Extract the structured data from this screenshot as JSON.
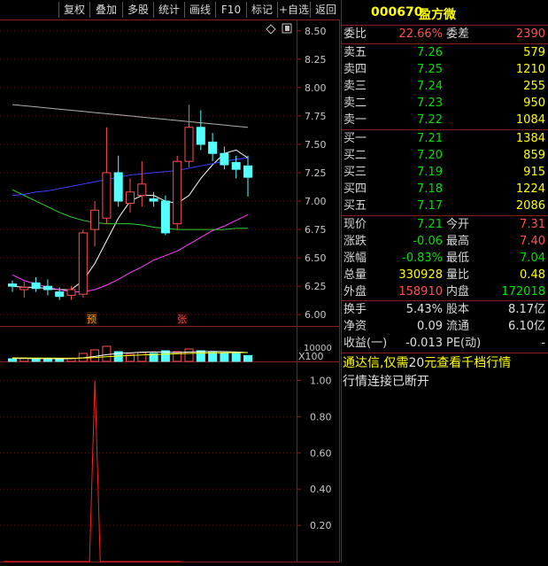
{
  "toolbar": {
    "buttons": [
      "复权",
      "叠加",
      "多股",
      "统计",
      "画线",
      "F10",
      "标记",
      "+自选",
      "返回"
    ]
  },
  "price_axis": [
    "8.50",
    "8.25",
    "8.00",
    "7.75",
    "7.50",
    "7.25",
    "7.00",
    "6.75",
    "6.50",
    "6.25",
    "6.00"
  ],
  "volume_axis": {
    "top": "10000",
    "unit": "X100"
  },
  "indicator_axis": [
    "1.00",
    "0.80",
    "0.60",
    "0.40",
    "0.20"
  ],
  "markers": {
    "yu": "预",
    "zhang": "张"
  },
  "stock": {
    "code": "000670",
    "name": "盈方微"
  },
  "ratio": {
    "label1": "委比",
    "value1": "22.66%",
    "label2": "委差",
    "value2": "2390"
  },
  "asks": [
    {
      "label": "卖五",
      "price": "7.26",
      "volume": "579"
    },
    {
      "label": "卖四",
      "price": "7.25",
      "volume": "1210"
    },
    {
      "label": "卖三",
      "price": "7.24",
      "volume": "255"
    },
    {
      "label": "卖二",
      "price": "7.23",
      "volume": "950"
    },
    {
      "label": "卖一",
      "price": "7.22",
      "volume": "1084"
    }
  ],
  "bids": [
    {
      "label": "买一",
      "price": "7.21",
      "volume": "1384"
    },
    {
      "label": "买二",
      "price": "7.20",
      "volume": "859"
    },
    {
      "label": "买三",
      "price": "7.19",
      "volume": "915"
    },
    {
      "label": "买四",
      "price": "7.18",
      "volume": "1224"
    },
    {
      "label": "买五",
      "price": "7.17",
      "volume": "2086"
    }
  ],
  "stats": [
    {
      "l1": "现价",
      "v1": "7.21",
      "l2": "今开",
      "v2": "7.31"
    },
    {
      "l1": "涨跌",
      "v1": "-0.06",
      "l2": "最高",
      "v2": "7.40"
    },
    {
      "l1": "涨幅",
      "v1": "-0.83%",
      "l2": "最低",
      "v2": "7.04"
    },
    {
      "l1": "总量",
      "v1": "330928",
      "l2": "量比",
      "v2": "0.48"
    },
    {
      "l1": "外盘",
      "v1": "158910",
      "l2": "内盘",
      "v2": "172018"
    }
  ],
  "fundamentals": [
    {
      "l1": "换手",
      "v1": "5.43%",
      "l2": "股本",
      "v2": "8.17亿"
    },
    {
      "l1": "净资",
      "v1": "0.09",
      "l2": "流通",
      "v2": "6.10亿"
    },
    {
      "l1": "收益(一)",
      "v1": "-0.013",
      "l2": "PE(动)",
      "v2": "-"
    }
  ],
  "notice": {
    "line1_a": "通达信,仅需",
    "line1_b": "20",
    "line1_c": "元查看千档行情",
    "line2": "行情连接已断开"
  },
  "colors": {
    "up": "#ff5050",
    "down": "#00e000",
    "accent": "#ffff00",
    "frame": "#8a1c1c"
  },
  "chart_data": [
    {
      "type": "candlestick",
      "ylim": [
        5.9,
        8.6
      ],
      "ticks": [
        8.5,
        8.25,
        8.0,
        7.75,
        7.5,
        7.25,
        7.0,
        6.75,
        6.5,
        6.25,
        6.0
      ],
      "candles": [
        {
          "o": 6.27,
          "h": 6.3,
          "l": 6.2,
          "c": 6.25
        },
        {
          "o": 6.22,
          "h": 6.29,
          "l": 6.15,
          "c": 6.24
        },
        {
          "o": 6.28,
          "h": 6.33,
          "l": 6.2,
          "c": 6.23
        },
        {
          "o": 6.25,
          "h": 6.31,
          "l": 6.17,
          "c": 6.22
        },
        {
          "o": 6.2,
          "h": 6.24,
          "l": 6.13,
          "c": 6.16
        },
        {
          "o": 6.17,
          "h": 6.25,
          "l": 6.13,
          "c": 6.22
        },
        {
          "o": 6.18,
          "h": 6.75,
          "l": 6.15,
          "c": 6.72
        },
        {
          "o": 6.75,
          "h": 7.0,
          "l": 6.6,
          "c": 6.92
        },
        {
          "o": 6.85,
          "h": 7.65,
          "l": 6.8,
          "c": 7.25
        },
        {
          "o": 7.25,
          "h": 7.4,
          "l": 6.95,
          "c": 7.0
        },
        {
          "o": 6.98,
          "h": 7.2,
          "l": 6.9,
          "c": 7.08
        },
        {
          "o": 7.05,
          "h": 7.35,
          "l": 6.95,
          "c": 7.15
        },
        {
          "o": 7.02,
          "h": 7.08,
          "l": 6.95,
          "c": 7.0
        },
        {
          "o": 7.0,
          "h": 7.05,
          "l": 6.7,
          "c": 6.72
        },
        {
          "o": 6.8,
          "h": 7.4,
          "l": 6.75,
          "c": 7.35
        },
        {
          "o": 7.35,
          "h": 7.85,
          "l": 7.3,
          "c": 7.65
        },
        {
          "o": 7.65,
          "h": 7.8,
          "l": 7.45,
          "c": 7.5
        },
        {
          "o": 7.52,
          "h": 7.6,
          "l": 7.35,
          "c": 7.42
        },
        {
          "o": 7.42,
          "h": 7.48,
          "l": 7.28,
          "c": 7.32
        },
        {
          "o": 7.34,
          "h": 7.4,
          "l": 7.2,
          "c": 7.28
        },
        {
          "o": 7.31,
          "h": 7.4,
          "l": 7.04,
          "c": 7.21
        }
      ],
      "ma_lines": [
        {
          "color": "#ffffff",
          "values": [
            6.25,
            6.24,
            6.24,
            6.23,
            6.22,
            6.22,
            6.3,
            6.45,
            6.65,
            6.85,
            7.0,
            7.05,
            7.05,
            7.0,
            6.98,
            7.05,
            7.2,
            7.32,
            7.42,
            7.45,
            7.38
          ]
        },
        {
          "color": "#ff40ff",
          "values": [
            6.35,
            6.3,
            6.27,
            6.24,
            6.22,
            6.2,
            6.2,
            6.22,
            6.26,
            6.31,
            6.37,
            6.42,
            6.48,
            6.52,
            6.56,
            6.62,
            6.68,
            6.74,
            6.78,
            6.83,
            6.88
          ]
        },
        {
          "color": "#30d030",
          "values": [
            7.1,
            7.05,
            7.0,
            6.95,
            6.9,
            6.86,
            6.83,
            6.81,
            6.8,
            6.8,
            6.8,
            6.79,
            6.77,
            6.76,
            6.75,
            6.75,
            6.75,
            6.75,
            6.75,
            6.76,
            6.76
          ]
        },
        {
          "color": "#4040ff",
          "values": [
            7.05,
            7.06,
            7.08,
            7.09,
            7.11,
            7.13,
            7.15,
            7.17,
            7.19,
            7.21,
            7.23,
            7.24,
            7.25,
            7.26,
            7.27,
            7.29,
            7.31,
            7.33,
            7.35,
            7.37,
            7.38
          ]
        },
        {
          "color": "#b0b0b0",
          "values": [
            7.85,
            7.84,
            7.83,
            7.82,
            7.81,
            7.8,
            7.79,
            7.78,
            7.77,
            7.76,
            7.75,
            7.74,
            7.73,
            7.72,
            7.71,
            7.7,
            7.69,
            7.68,
            7.67,
            7.66,
            7.65
          ]
        }
      ]
    },
    {
      "type": "bar",
      "ylim": [
        0,
        10000
      ],
      "values": [
        1500,
        1800,
        1600,
        1400,
        1300,
        1700,
        4500,
        6500,
        8500,
        5500,
        4000,
        5000,
        4500,
        6000,
        5500,
        7000,
        6000,
        5000,
        4800,
        4500,
        3300
      ],
      "ma_lines": [
        {
          "color": "#ffffff",
          "values": [
            1700,
            1650,
            1600,
            1550,
            1500,
            1550,
            2000,
            2800,
            3800,
            4500,
            4800,
            5200,
            5400,
            5200,
            5000,
            5300,
            5500,
            5600,
            5500,
            5300,
            5000
          ]
        },
        {
          "color": "#ffff00",
          "values": [
            2000,
            1950,
            1900,
            1850,
            1800,
            1800,
            1900,
            2200,
            2600,
            3000,
            3300,
            3600,
            3900,
            4100,
            4300,
            4500,
            4700,
            4800,
            4900,
            4950,
            5000
          ]
        }
      ]
    },
    {
      "type": "line",
      "ylim": [
        0,
        1.1
      ],
      "ticks": [
        1.0,
        0.8,
        0.6,
        0.4,
        0.2
      ],
      "values": [
        0,
        0,
        0,
        0,
        0,
        0,
        0,
        0,
        0,
        0,
        0,
        0,
        0,
        0,
        0,
        0,
        0,
        1.0,
        0,
        0,
        0,
        0,
        0,
        0,
        0,
        0,
        0,
        0,
        0,
        0,
        0,
        0,
        0,
        0
      ],
      "color": "#ff2020"
    }
  ]
}
